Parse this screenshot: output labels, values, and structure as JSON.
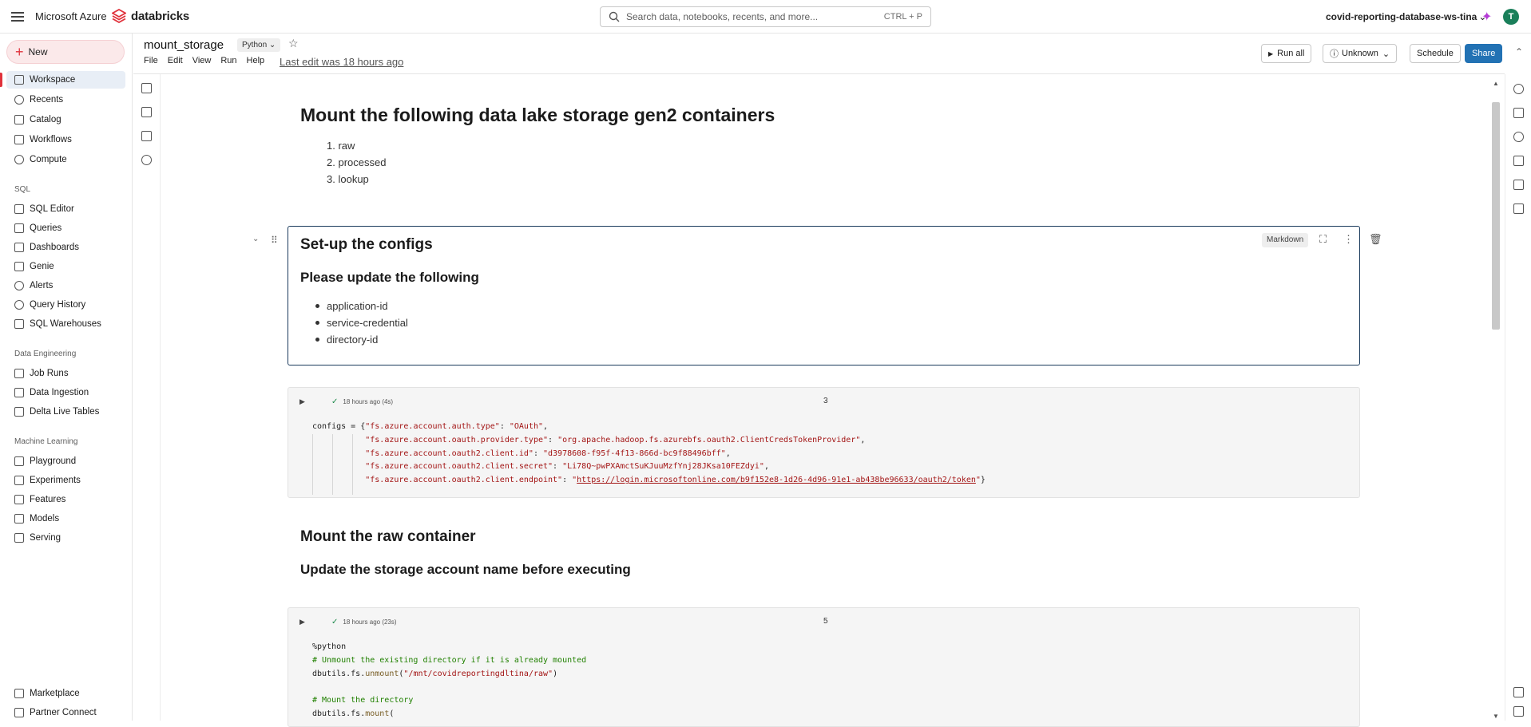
{
  "topbar": {
    "ms_azure": "Microsoft Azure",
    "brand": "databricks",
    "search_placeholder": "Search data, notebooks, recents, and more...",
    "search_shortcut": "CTRL + P",
    "workspace": "covid-reporting-database-ws-tina",
    "avatar_initial": "T"
  },
  "sidebar": {
    "new_label": "New",
    "items_main": [
      "Workspace",
      "Recents",
      "Catalog",
      "Workflows",
      "Compute"
    ],
    "section_sql": "SQL",
    "items_sql": [
      "SQL Editor",
      "Queries",
      "Dashboards",
      "Genie",
      "Alerts",
      "Query History",
      "SQL Warehouses"
    ],
    "section_de": "Data Engineering",
    "items_de": [
      "Job Runs",
      "Data Ingestion",
      "Delta Live Tables"
    ],
    "section_ml": "Machine Learning",
    "items_ml": [
      "Playground",
      "Experiments",
      "Features",
      "Models",
      "Serving"
    ],
    "items_bottom": [
      "Marketplace",
      "Partner Connect"
    ]
  },
  "notebook": {
    "title": "mount_storage",
    "language": "Python",
    "menu": [
      "File",
      "Edit",
      "View",
      "Run",
      "Help"
    ],
    "last_edit": "Last edit was 18 hours ago",
    "run_all": "Run all",
    "compute": "Unknown",
    "schedule": "Schedule",
    "share": "Share"
  },
  "cells": {
    "intro_heading": "Mount the following data lake storage gen2 containers",
    "intro_list": [
      "raw",
      "processed",
      "lookup"
    ],
    "config_heading": "Set-up the configs",
    "config_subheading": "Please update the following",
    "config_list": [
      "application-id",
      "service-credential",
      "directory-id"
    ],
    "md_badge": "Markdown",
    "cell3_status": "18 hours ago (4s)",
    "cell3_number": "3",
    "raw_heading": "Mount the raw container",
    "raw_subheading": "Update the storage account name before executing",
    "cell5_status": "18 hours ago (23s)",
    "cell5_number": "5"
  },
  "code3": {
    "l1_a": "configs = {",
    "l1_key": "\"fs.azure.account.auth.type\"",
    "l1_val": "\"OAuth\"",
    "l2_key": "\"fs.azure.account.oauth.provider.type\"",
    "l2_val": "\"org.apache.hadoop.fs.azurebfs.oauth2.ClientCredsTokenProvider\"",
    "l3_key": "\"fs.azure.account.oauth2.client.id\"",
    "l3_val": "\"d3978608-f95f-4f13-866d-bc9f88496bff\"",
    "l4_key": "\"fs.azure.account.oauth2.client.secret\"",
    "l4_val": "\"Li78Q~pwPXAmctSuKJuuMzfYnj28JKsa10FEZdyi\"",
    "l5_key": "\"fs.azure.account.oauth2.client.endpoint\"",
    "l5_val": "https://login.microsoftonline.com/b9f152e8-1d26-4d96-91e1-ab438be96633/oauth2/token"
  },
  "code5": {
    "l1": "%python",
    "l2": "# Unmount the existing directory if it is already mounted",
    "l3_a": "dbutils.fs.",
    "l3_f": "unmount",
    "l3_s": "\"/mnt/covidreportingdltina/raw\"",
    "l5": "# Mount the directory",
    "l6_a": "dbutils.fs.",
    "l6_f": "mount"
  }
}
